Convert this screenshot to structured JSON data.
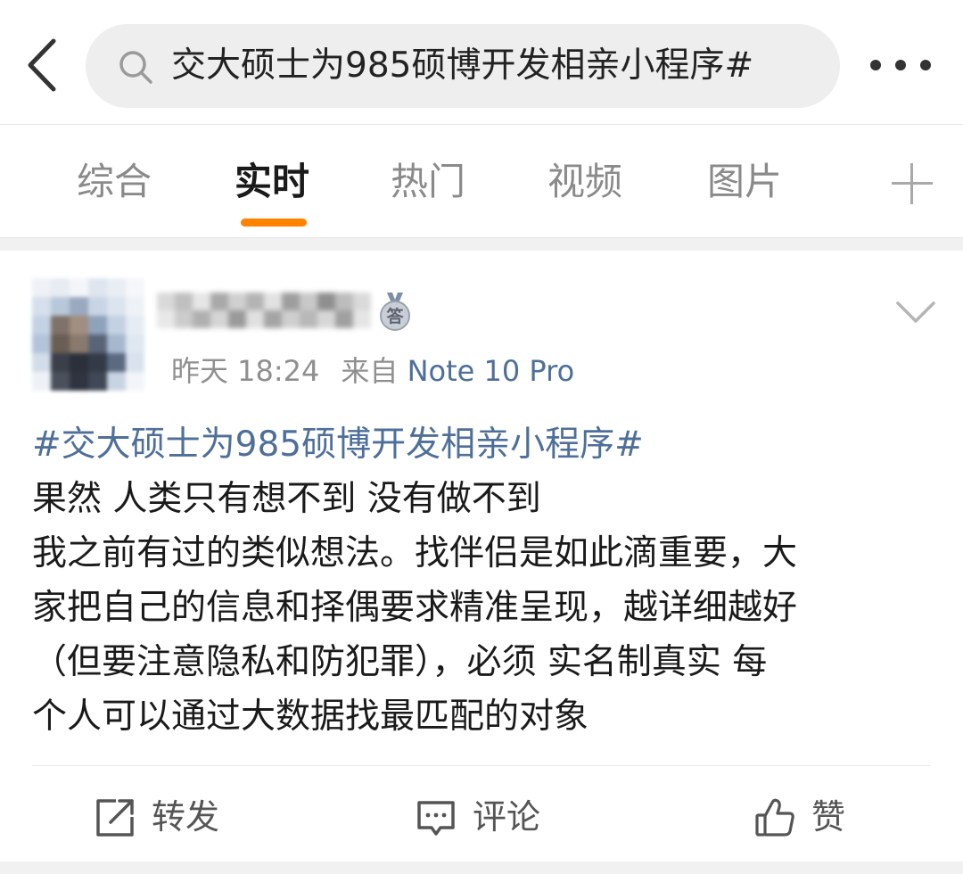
{
  "search": {
    "query": "交大硕士为985硕博开发相亲小程序#"
  },
  "tabs": [
    {
      "label": "综合"
    },
    {
      "label": "实时"
    },
    {
      "label": "热门"
    },
    {
      "label": "视频"
    },
    {
      "label": "图片"
    }
  ],
  "active_tab": "实时",
  "post": {
    "badge": "答",
    "time": "昨天 18:24",
    "source_prefix": "来自",
    "source": "Note 10 Pro",
    "hashtag": "#交大硕士为985硕博开发相亲小程序#",
    "lines": [
      "果然 人类只有想不到 没有做不到",
      "我之前有过的类似想法。找伴侣是如此滴重要，大",
      "家把自己的信息和择偶要求精准呈现，越详细越好",
      "（但要注意隐私和防犯罪），必须 实名制真实 每",
      "个人可以通过大数据找最匹配的对象"
    ]
  },
  "actions": {
    "repost": "转发",
    "comment": "评论",
    "like": "赞"
  },
  "colors": {
    "accent": "#ff8200",
    "link": "#4e6f9a",
    "search_bg": "#eeeeee"
  }
}
